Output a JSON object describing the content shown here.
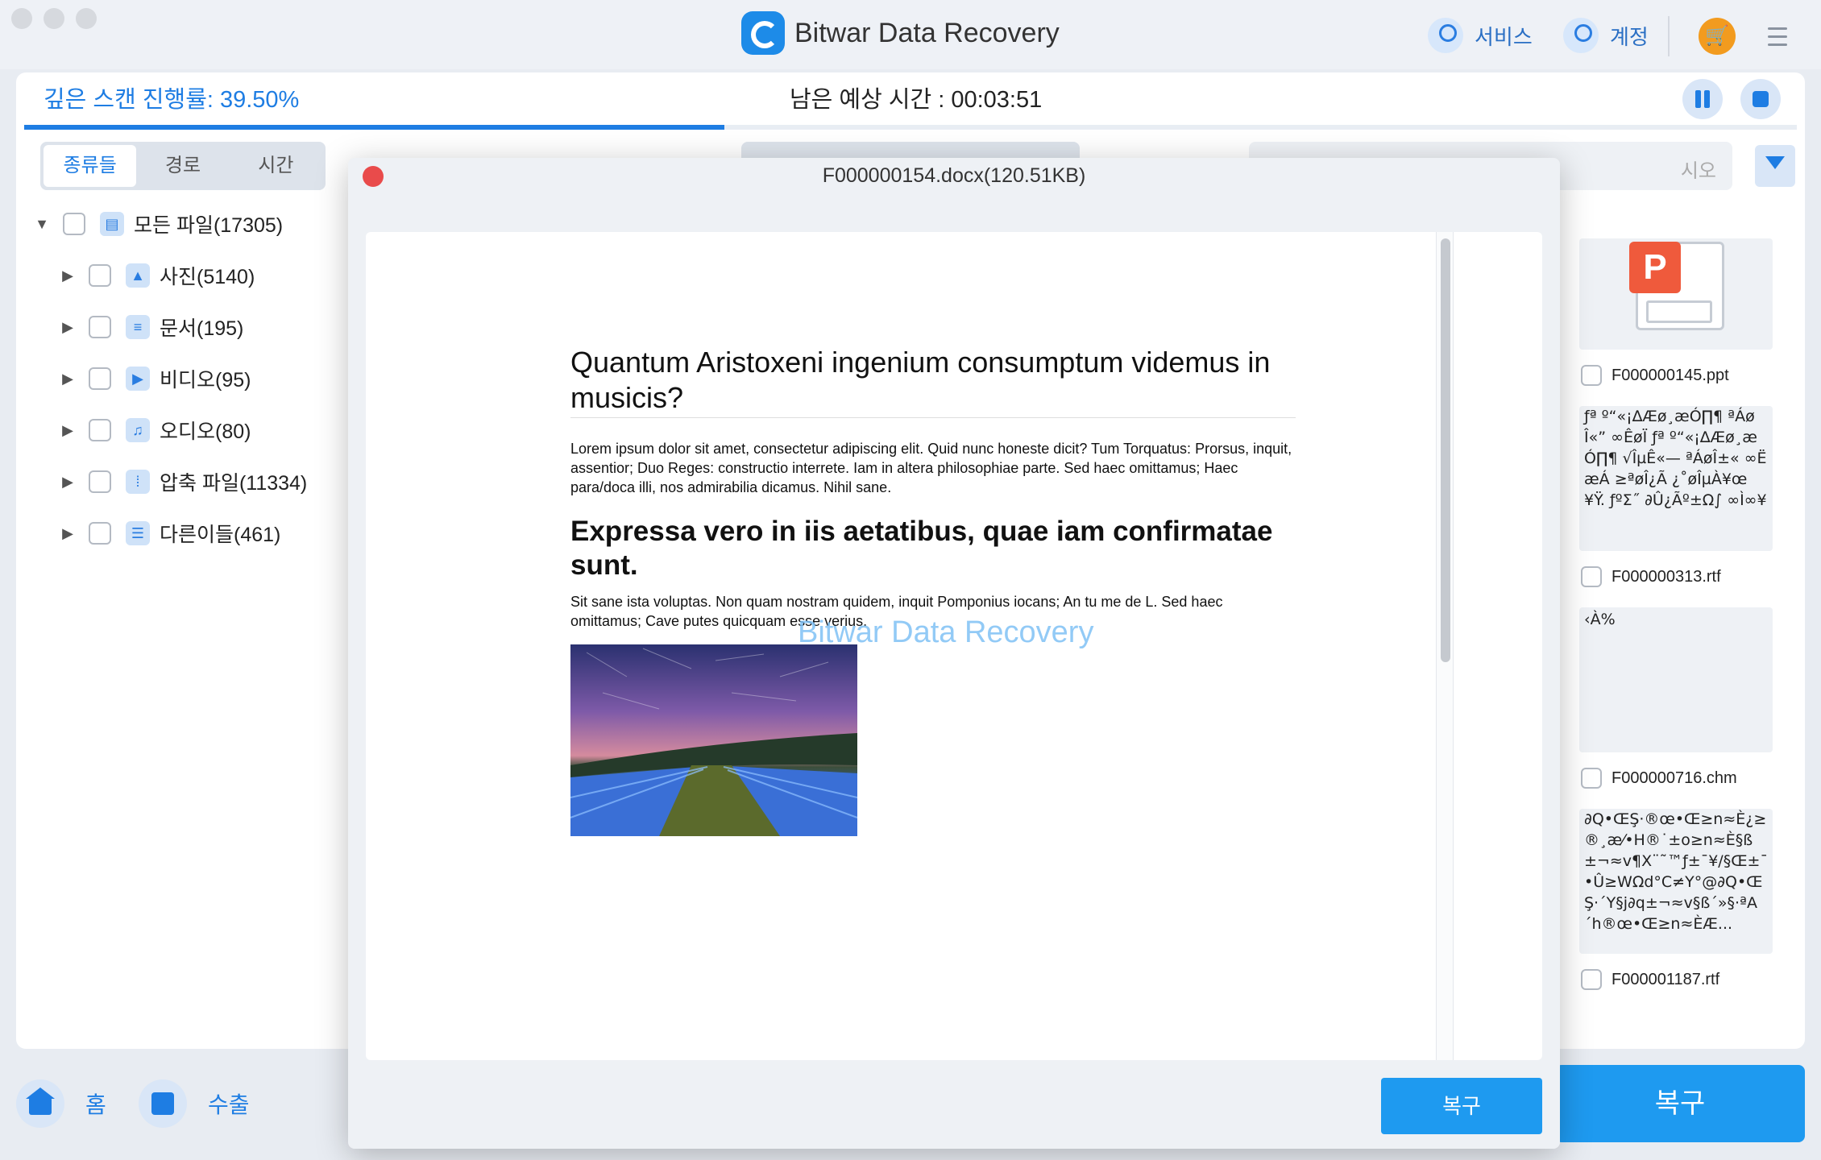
{
  "app": {
    "title": "Bitwar Data Recovery"
  },
  "header": {
    "service_label": "서비스",
    "account_label": "계정"
  },
  "scan": {
    "progress_label": "깊은 스캔 진행률: 39.50%",
    "progress_fraction": 0.395,
    "remaining_label": "남은 예상 시간 : 00:03:51"
  },
  "tabs": [
    {
      "label": "종류들",
      "active": true
    },
    {
      "label": "경로",
      "active": false
    },
    {
      "label": "시간",
      "active": false
    }
  ],
  "tree": {
    "root": {
      "label": "모든 파일(17305)"
    },
    "items": [
      {
        "label": "사진(5140)",
        "icon": "image-icon"
      },
      {
        "label": "문서(195)",
        "icon": "document-icon"
      },
      {
        "label": "비디오(95)",
        "icon": "video-icon"
      },
      {
        "label": "오디오(80)",
        "icon": "audio-icon"
      },
      {
        "label": "압축 파일(11334)",
        "icon": "archive-icon"
      },
      {
        "label": "다른이들(461)",
        "icon": "other-files-icon"
      }
    ]
  },
  "search": {
    "placeholder_tail": "시오"
  },
  "thumbs": [
    {
      "name": "F000000145.ppt",
      "text": ""
    },
    {
      "name": "F000000313.rtf",
      "text": "ƒª º“«¡∆Æø¸æÓ∏¶ ªÁøÎ«” ∞ÊøÏ ƒª º“«¡∆Æø¸æÓ∏¶ √ÎµÊ«— ªÁøÎ±« ∞ËæÁ ≥ªøÎ¿Ã ¿˚øÎµÀ¥œ¥Ÿ. ƒºΣ˝ ∂Û¿Ãº±Ω∫ ∞Ì∞¥"
    },
    {
      "name": "F000000716.chm",
      "text": "‹À%"
    },
    {
      "name": "F000001187.rtf",
      "text": "∂Q•ŒŞ·®œ•Œ≥n≈È¿≥®¸æ⁄•H®˙±o≥n≈È§ß±¬≈v¶X¨˜™ƒ±¯¥/§Œ±¯•Û≥WΩd°C≠Y°@∂Q•ŒŞ·´Y§j∂q±¬≈v§ß´»§·ªA´h®œ•Œ≥n≈ÈÆ..."
    }
  ],
  "bottom": {
    "home_label": "홈",
    "export_label": "수출",
    "recover_label": "복구"
  },
  "modal": {
    "title": "F000000154.docx(120.51KB)",
    "recover_label": "복구",
    "watermark": "Bitwar Data Recovery",
    "doc": {
      "heading1": "Quantum Aristoxeni ingenium consumptum videmus in musicis?",
      "para1": "Lorem ipsum dolor sit amet, consectetur adipiscing elit. Quid nunc honeste dicit? Tum Torquatus: Prorsus, inquit, assentior; Duo Reges: constructio interrete. Iam in altera philosophiae parte. Sed haec omittamus; Haec para/doca illi, nos admirabilia dicamus. Nihil sane.",
      "heading2": "Expressa vero in iis aetatibus, quae iam confirmatae sunt.",
      "para2": "Sit sane ista voluptas. Non quam nostram quidem, inquit Pomponius iocans; An tu me de L. Sed haec omittamus; Cave putes quicquam esse verius."
    }
  }
}
